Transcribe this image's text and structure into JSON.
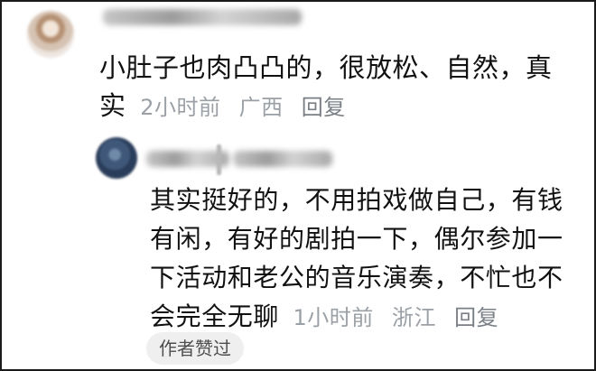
{
  "comment": {
    "text": "小肚子也肉凸凸的，很放松、自然，真实",
    "time": "2小时前",
    "location": "广西",
    "reply_label": "回复"
  },
  "reply": {
    "text": "其实挺好的，不用拍戏做自己，有钱有闲，有好的剧拍一下，偶尔参加一下活动和老公的音乐演奏，不忙也不会完全无聊",
    "time": "1小时前",
    "location": "浙江",
    "reply_label": "回复",
    "badge": "作者赞过"
  }
}
